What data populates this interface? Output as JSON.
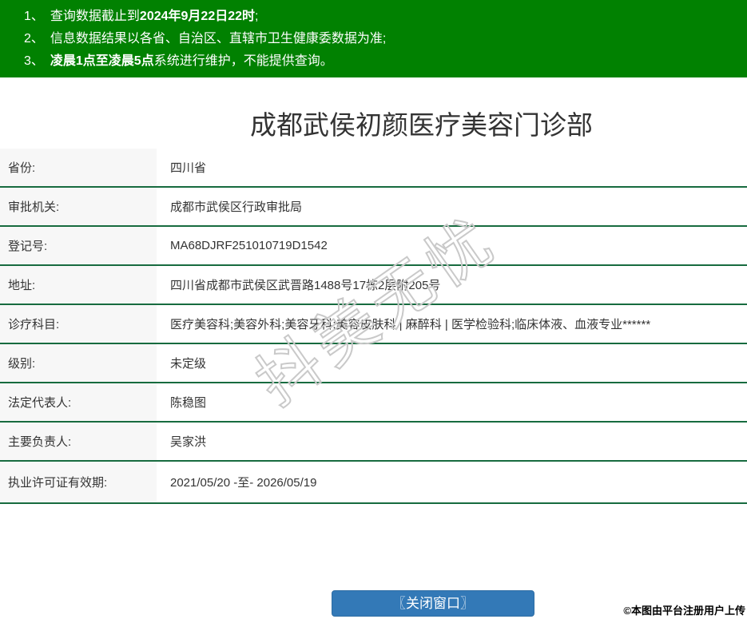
{
  "notice": {
    "items": [
      {
        "num": "1、",
        "pre": "查询数据截止到",
        "bold": "2024年9月22日22时",
        "post": ";"
      },
      {
        "num": "2、",
        "pre": "信息数据结果以各省、自治区、直辖市卫生健康委数据为准;",
        "bold": "",
        "post": ""
      },
      {
        "num": "3、",
        "pre": "",
        "bold": "凌晨1点至凌晨5点",
        "post": "系统进行维护，不能提供查询。"
      }
    ]
  },
  "header": {
    "title": "成都武侯初颜医疗美容门诊部"
  },
  "table": {
    "rows": [
      {
        "label": "省份:",
        "value": "四川省"
      },
      {
        "label": "审批机关:",
        "value": "成都市武侯区行政审批局"
      },
      {
        "label": "登记号:",
        "value": "MA68DJRF251010719D1542"
      },
      {
        "label": "地址:",
        "value": "四川省成都市武侯区武晋路1488号17栋2层附205号"
      },
      {
        "label": "诊疗科目:",
        "value": "医疗美容科;美容外科;美容牙科;美容皮肤科 | 麻醉科 | 医学检验科;临床体液、血液专业******"
      },
      {
        "label": "级别:",
        "value": "未定级"
      },
      {
        "label": "法定代表人:",
        "value": "陈稳图"
      },
      {
        "label": "主要负责人:",
        "value": "吴家洪"
      },
      {
        "label": "执业许可证有效期:",
        "value": "2021/05/20 -至- 2026/05/19"
      }
    ]
  },
  "watermark": {
    "text": "抖美无忧"
  },
  "footer": {
    "close_button_label": "〖关闭窗口〗",
    "copyright": "©本图由平台注册用户上传"
  },
  "colors": {
    "banner_green": "#018101",
    "divider_green": "#176b3f",
    "button_blue": "#3379b7",
    "label_bg": "#f7f7f7"
  }
}
